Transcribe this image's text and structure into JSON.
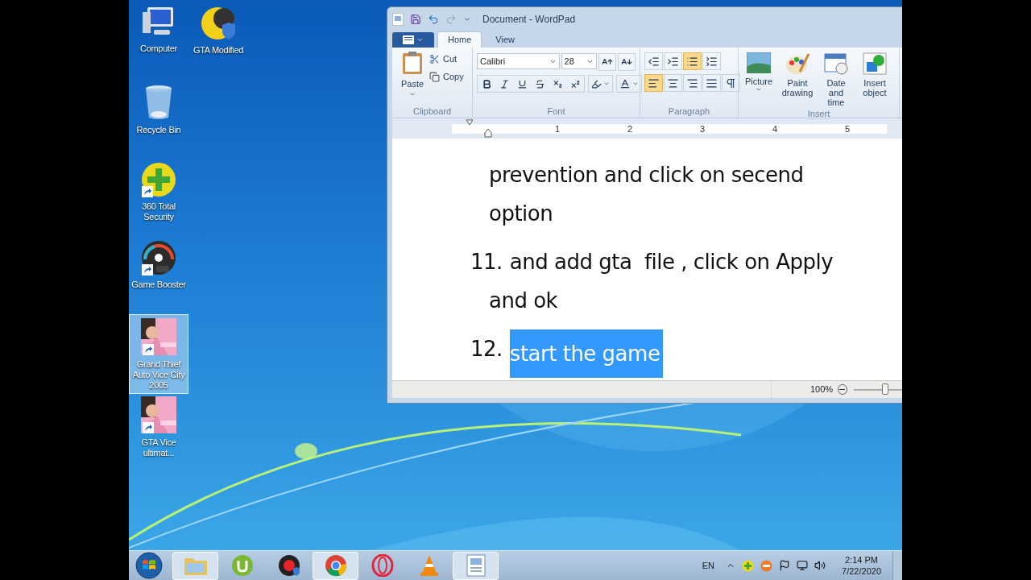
{
  "desktop_icons": [
    {
      "label": "Computer",
      "kind": "computer",
      "shortcut": false,
      "selected": false
    },
    {
      "label": "GTA Modified",
      "kind": "moon-shield",
      "shortcut": false,
      "selected": false
    },
    {
      "label": "Recycle Bin",
      "kind": "recycle-bin",
      "shortcut": false,
      "selected": false
    },
    {
      "label": "360 Total Security",
      "kind": "plus-badge",
      "shortcut": true,
      "selected": false
    },
    {
      "label": "Game Booster",
      "kind": "gauge",
      "shortcut": true,
      "selected": false
    },
    {
      "label": "Grand Thief Auto Vice City 2005",
      "kind": "picture",
      "shortcut": true,
      "selected": true
    },
    {
      "label": "GTA Vice ultimat...",
      "kind": "picture",
      "shortcut": true,
      "selected": false
    }
  ],
  "window": {
    "title": "Document - WordPad",
    "tabs": [
      {
        "label": "Home",
        "selected": true
      },
      {
        "label": "View",
        "selected": false
      }
    ],
    "clipboard": {
      "group": "Clipboard",
      "paste": "Paste",
      "cut": "Cut",
      "copy": "Copy"
    },
    "font": {
      "group": "Font",
      "family": "Calibri",
      "size": "28"
    },
    "paragraph": {
      "group": "Paragraph",
      "row1": [
        {
          "kind": "outdent",
          "selected": false
        },
        {
          "kind": "indent",
          "selected": false
        },
        {
          "kind": "list",
          "selected": true
        },
        {
          "kind": "spacing",
          "selected": false
        }
      ],
      "row2": [
        {
          "kind": "left",
          "selected": true
        },
        {
          "kind": "center",
          "selected": false
        },
        {
          "kind": "right",
          "selected": false
        },
        {
          "kind": "justify",
          "selected": false
        },
        {
          "kind": "pilcrow",
          "selected": false
        }
      ]
    },
    "insert": {
      "group": "Insert",
      "buttons": [
        {
          "label": "Picture",
          "kind": "picture",
          "menu": true
        },
        {
          "label": "Paint drawing",
          "kind": "paint",
          "menu": false
        },
        {
          "label": "Date and time",
          "kind": "calendar",
          "menu": false
        },
        {
          "label": "Insert object",
          "kind": "object",
          "menu": false
        }
      ]
    },
    "ruler_marks": [
      "1",
      "2",
      "3",
      "4",
      "5"
    ],
    "document": [
      {
        "lines": [
          "prevention and click on secend",
          "option"
        ],
        "selected": false
      },
      {
        "number": "11.",
        "lines": [
          "and add gta  file , click on Apply",
          "and ok"
        ],
        "selected": false
      },
      {
        "number": "12.",
        "lines": [
          "start the game"
        ],
        "selected": true
      }
    ],
    "status_bar": {
      "zoom": "100%",
      "level": 0.5
    }
  },
  "taskbar": {
    "apps": [
      {
        "kind": "folder",
        "running": true
      },
      {
        "kind": "utorrent",
        "running": false
      },
      {
        "kind": "record",
        "running": false
      },
      {
        "kind": "chrome",
        "running": true
      },
      {
        "kind": "opera",
        "running": false
      },
      {
        "kind": "cone",
        "running": false
      },
      {
        "kind": "wordpad",
        "running": true
      }
    ],
    "language": "EN",
    "time": "2:14 PM",
    "date": "7/22/2020"
  }
}
